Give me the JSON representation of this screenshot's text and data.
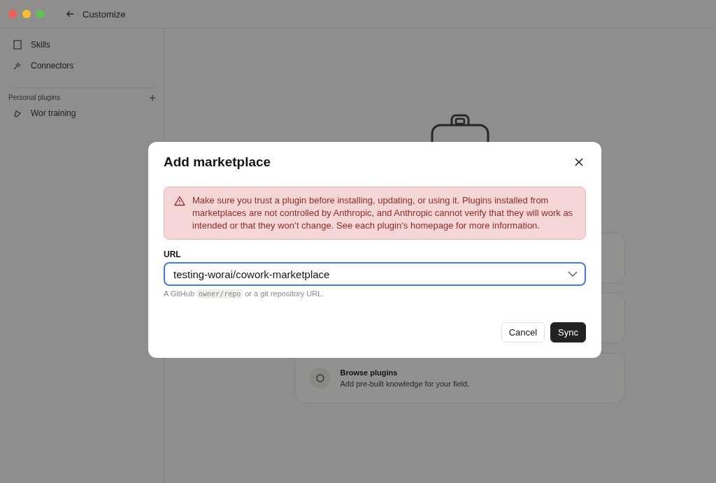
{
  "window": {
    "title": "Customize",
    "controls": [
      {
        "color": "#ee5f58"
      },
      {
        "color": "#f8be33"
      },
      {
        "color": "#5fc453"
      }
    ]
  },
  "sidebar": {
    "items": [
      {
        "label": "Skills",
        "kind": "skills"
      },
      {
        "label": "Connectors",
        "kind": "connectors"
      }
    ],
    "section": {
      "title": "Personal plugins",
      "items": [
        {
          "label": "Wor training",
          "kind": "plugin"
        }
      ]
    }
  },
  "main": {
    "cards": [
      {
        "kind": "blank"
      },
      {
        "kind": "blank"
      },
      {
        "kind": "browse",
        "title": "Browse plugins",
        "description": "Add pre-built knowledge for your field."
      }
    ]
  },
  "dialog": {
    "title": "Add marketplace",
    "warning": "Make sure you trust a plugin before installing, updating, or using it. Plugins installed from marketplaces are not controlled by Anthropic, and Anthropic cannot verify that they will work as intended or that they won’t change. See each plugin’s homepage for more information.",
    "field": {
      "label": "URL",
      "value": "testing-worai/cowork-marketplace",
      "focused": true
    },
    "hint": {
      "before": "A GitHub",
      "code": "owner/repo",
      "after": "or a git repository URL."
    },
    "buttons": [
      {
        "label": "Cancel",
        "kind": "secondary"
      },
      {
        "label": "Sync",
        "kind": "primary"
      }
    ]
  }
}
